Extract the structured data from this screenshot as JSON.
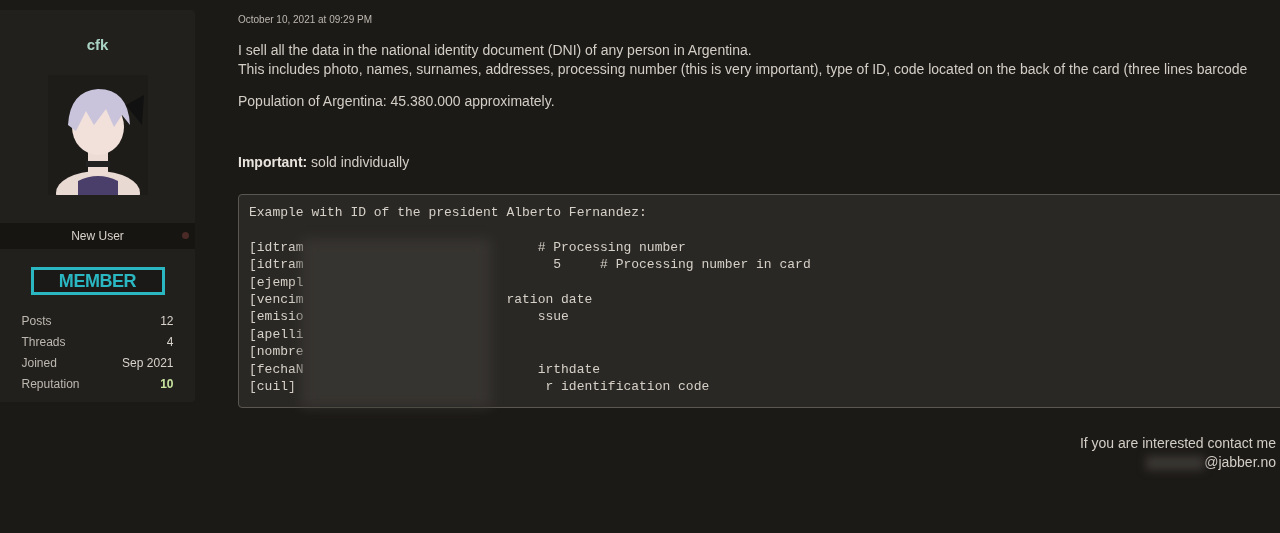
{
  "user": {
    "name": "cfk",
    "title": "New User",
    "online": false,
    "badge": "MEMBER",
    "stats": [
      {
        "label": "Posts",
        "value": "12",
        "highlight": false
      },
      {
        "label": "Threads",
        "value": "4",
        "highlight": false
      },
      {
        "label": "Joined",
        "value": "Sep 2021",
        "highlight": false
      },
      {
        "label": "Reputation",
        "value": "10",
        "highlight": true
      }
    ]
  },
  "post": {
    "date": "October 10, 2021 at 09:29 PM",
    "paragraphs": [
      {
        "lines": [
          "I sell all the data in the national identity document (DNI) of any person in Argentina.",
          "This includes photo, names, surnames, addresses, processing number (this is very important), type of ID, code located on the back of the card (three lines barcode"
        ]
      },
      {
        "lines": [
          "Population of Argentina: 45.380.000 approximately."
        ]
      },
      {
        "lines": [
          "**Important:** sold individually"
        ]
      }
    ],
    "code": {
      "heading": "Example with ID of the president Alberto Fernandez:",
      "lines": [
        {
          "left": "[idtram",
          "right": "# Processing number"
        },
        {
          "left": "[idtram",
          "right": "5     # Processing number in card"
        },
        {
          "left": "[ejempl"
        },
        {
          "left": "[vencim",
          "right": "ration date"
        },
        {
          "left": "[emisio",
          "right": "ssue"
        },
        {
          "left": "[apelli"
        },
        {
          "left": "[nombre"
        },
        {
          "left": "[fechaN",
          "right": "irthdate"
        },
        {
          "left": "[cuil]",
          "right": "r identification code"
        }
      ]
    },
    "contact": {
      "line": "If you are interested contact me",
      "address": "@jabber.no"
    }
  }
}
